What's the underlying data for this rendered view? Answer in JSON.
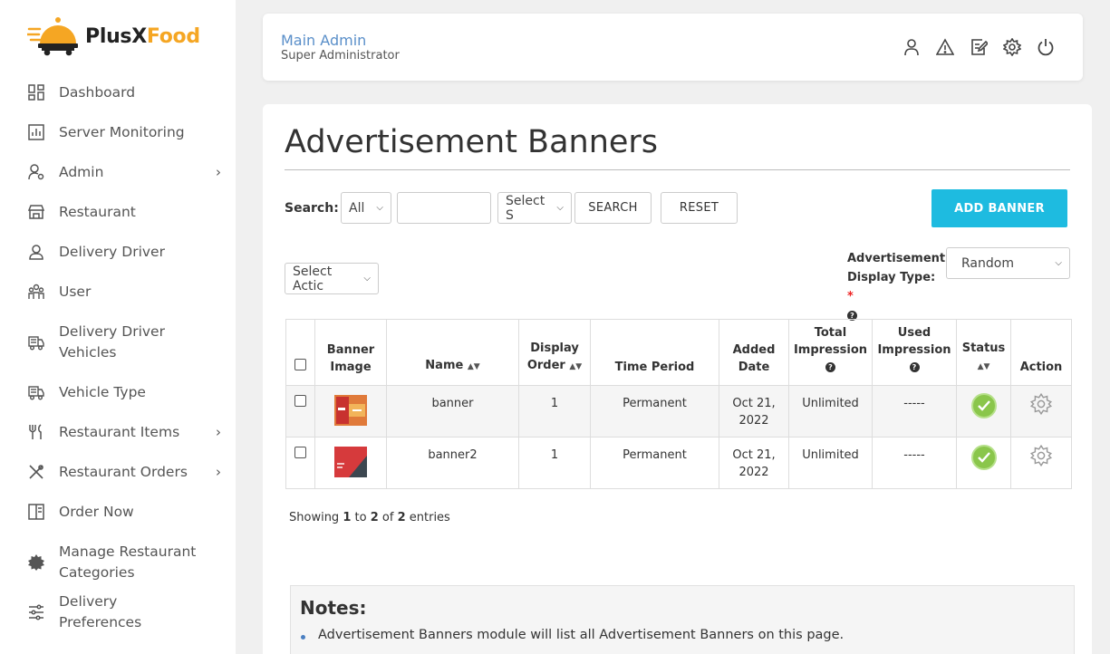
{
  "brand": {
    "name_part1": "PlusX",
    "name_part2": "Food"
  },
  "sidebar": {
    "items": [
      {
        "label": "Dashboard",
        "icon": "dashboard-icon",
        "has_submenu": false
      },
      {
        "label": "Server Monitoring",
        "icon": "chart-icon",
        "has_submenu": false
      },
      {
        "label": "Admin",
        "icon": "user-settings-icon",
        "has_submenu": true
      },
      {
        "label": "Restaurant",
        "icon": "store-icon",
        "has_submenu": false
      },
      {
        "label": "Delivery Driver",
        "icon": "driver-icon",
        "has_submenu": false
      },
      {
        "label": "User",
        "icon": "users-icon",
        "has_submenu": false
      },
      {
        "label": "Delivery Driver Vehicles",
        "icon": "truck-icon",
        "has_submenu": false
      },
      {
        "label": "Vehicle Type",
        "icon": "truck-icon",
        "has_submenu": false
      },
      {
        "label": "Restaurant Items",
        "icon": "fork-knife-icon",
        "has_submenu": true
      },
      {
        "label": "Restaurant Orders",
        "icon": "utensils-cross-icon",
        "has_submenu": true
      },
      {
        "label": "Order Now",
        "icon": "menu-book-icon",
        "has_submenu": false
      },
      {
        "label": "Manage Restaurant Categories",
        "icon": "gear-badge-icon",
        "has_submenu": false
      },
      {
        "label": "Delivery Preferences",
        "icon": "sliders-icon",
        "has_submenu": false
      }
    ]
  },
  "header": {
    "name": "Main Admin",
    "role": "Super Administrator",
    "icons": [
      "profile-icon",
      "alert-icon",
      "edit-icon",
      "settings-icon",
      "power-icon"
    ]
  },
  "page": {
    "title": "Advertisement Banners",
    "search_label": "Search:",
    "search_scope": "All",
    "search_status": "Select S",
    "search_button": "SEARCH",
    "reset_button": "RESET",
    "add_button": "ADD BANNER",
    "bulk_action": "Select Actic",
    "display_type_label": "Advertisement Display Type:",
    "display_type_required": "*",
    "display_type_value": "Random"
  },
  "table": {
    "headers": {
      "banner_image": "Banner Image",
      "name": "Name",
      "display_order": "Display Order",
      "time_period": "Time Period",
      "added_date": "Added Date",
      "total_impression": "Total Impression",
      "used_impression": "Used Impression",
      "status": "Status",
      "action": "Action"
    },
    "rows": [
      {
        "name": "banner",
        "display_order": "1",
        "time_period": "Permanent",
        "added_date": "Oct 21, 2022",
        "total_impression": "Unlimited",
        "used_impression": "-----",
        "status": "active"
      },
      {
        "name": "banner2",
        "display_order": "1",
        "time_period": "Permanent",
        "added_date": "Oct 21, 2022",
        "total_impression": "Unlimited",
        "used_impression": "-----",
        "status": "active"
      }
    ]
  },
  "pagination": {
    "prefix": "Showing",
    "from": "1",
    "to_word": "to",
    "to": "2",
    "of_word": "of",
    "total": "2",
    "suffix": "entries"
  },
  "notes": {
    "title": "Notes:",
    "items": [
      "Advertisement Banners module will list all Advertisement Banners on this page."
    ]
  },
  "colors": {
    "accent": "#1ebbe0",
    "brand_orange": "#f5a623",
    "admin_name": "#5a8fc9",
    "status_green": "#8ac64b"
  }
}
